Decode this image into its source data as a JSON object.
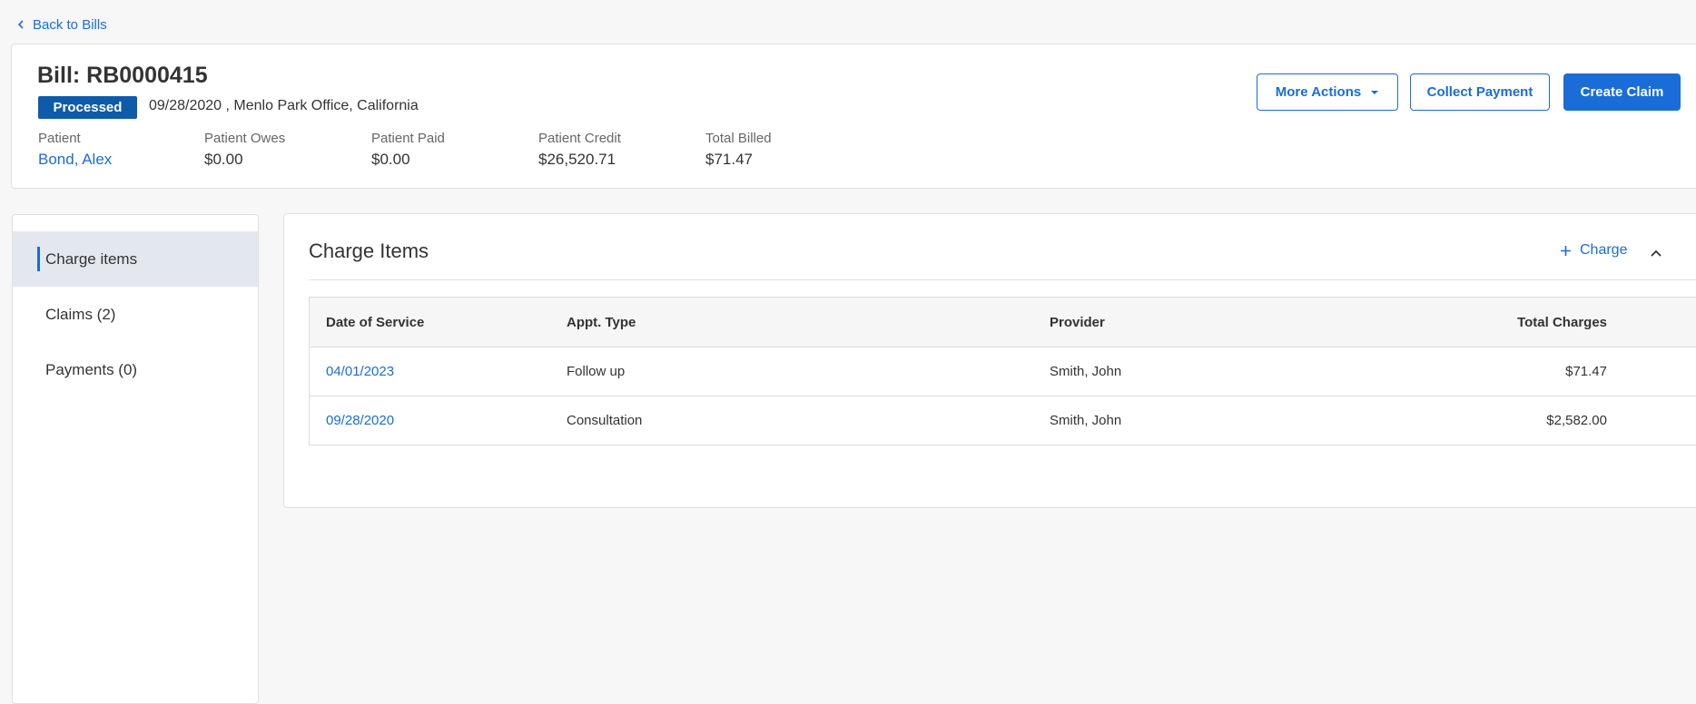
{
  "nav": {
    "back_label": "Back to Bills"
  },
  "bill": {
    "title": "Bill: RB0000415",
    "status": "Processed",
    "subtitle": "09/28/2020 , Menlo Park Office, California"
  },
  "summary": [
    {
      "label": "Patient",
      "value": "Bond, Alex"
    },
    {
      "label": "Patient Owes",
      "value": "$0.00"
    },
    {
      "label": "Patient Paid",
      "value": "$0.00"
    },
    {
      "label": "Patient Credit",
      "value": "$26,520.71"
    },
    {
      "label": "Total Billed",
      "value": "$71.47"
    }
  ],
  "actions": {
    "more_actions": "More Actions",
    "collect_payment": "Collect Payment",
    "create_claim": "Create Claim"
  },
  "sidebar": {
    "items": [
      {
        "label": "Charge items",
        "active": true
      },
      {
        "label": "Claims (2)",
        "active": false
      },
      {
        "label": "Payments (0)",
        "active": false
      }
    ]
  },
  "charges": {
    "title": "Charge Items",
    "add_label": "Charge",
    "columns": [
      "Date of Service",
      "Appt. Type",
      "Provider",
      "Total Charges"
    ],
    "rows": [
      {
        "date": "04/01/2023",
        "type": "Follow up",
        "provider": "Smith, John",
        "total": "$71.47"
      },
      {
        "date": "09/28/2020",
        "type": "Consultation",
        "provider": "Smith, John",
        "total": "$2,582.00"
      }
    ]
  },
  "colors": {
    "accent": "#1a6dd6",
    "status_badge": "#0e5baa",
    "active_nav_bg": "#e3e8ef"
  }
}
